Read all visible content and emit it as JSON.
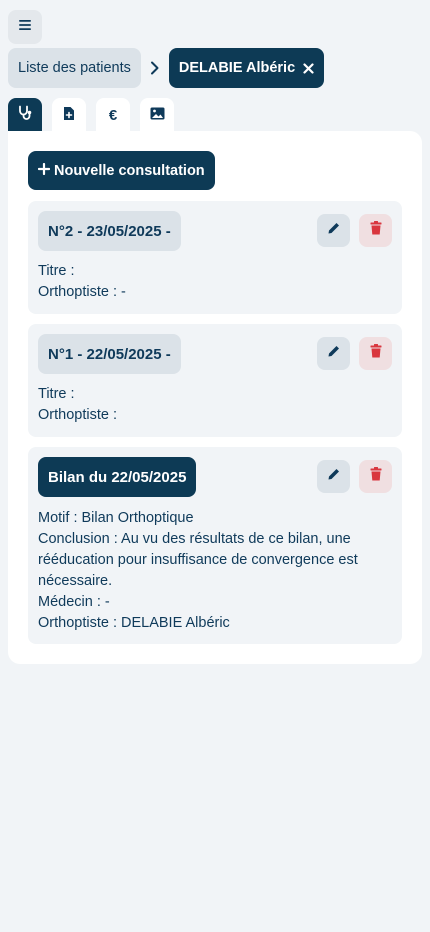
{
  "nav": {
    "menu_icon": "hamburger-icon"
  },
  "breadcrumb": {
    "patients_label": "Liste des patients",
    "separator_icon": "chevron-right-icon",
    "current_patient": "DELABIE Albéric",
    "close_icon": "close-icon"
  },
  "tabs": [
    {
      "icon": "stethoscope-icon",
      "active": true
    },
    {
      "icon": "file-plus-icon",
      "active": false
    },
    {
      "icon": "euro-icon",
      "label": "€",
      "active": false
    },
    {
      "icon": "image-icon",
      "active": false
    }
  ],
  "actions": {
    "new_consultation_label": "Nouvelle consultation",
    "plus_icon": "plus-icon"
  },
  "consultations": [
    {
      "title": "N°2 - 23/05/2025 -",
      "lines": [
        "Titre :",
        "Orthoptiste : -"
      ]
    },
    {
      "title": "N°1 - 22/05/2025 -",
      "lines": [
        "Titre :",
        "Orthoptiste :"
      ]
    },
    {
      "title": "Bilan du 22/05/2025",
      "lines": [
        "Motif : Bilan Orthoptique",
        "Conclusion : Au vu des résultats de ce bilan, une rééducation pour insuffisance de convergence est nécessaire.",
        "Médecin : -",
        "Orthoptiste : DELABIE Albéric"
      ]
    }
  ],
  "colors": {
    "primary": "#0d3a55",
    "background": "#f1f4f7",
    "chip": "#dbe2e8",
    "delete_bg": "#f0dfe1",
    "delete_icon": "#d9363e"
  }
}
